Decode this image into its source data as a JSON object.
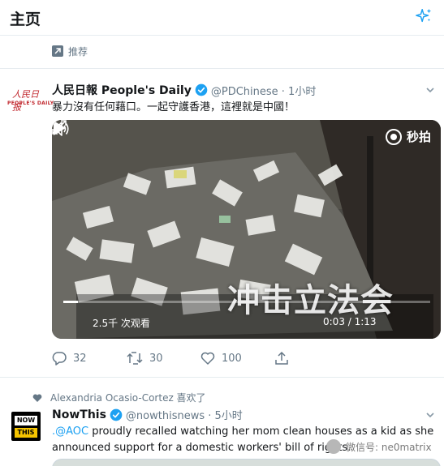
{
  "header": {
    "title": "主页",
    "sparkle_icon": "sparkle-icon"
  },
  "promoted": {
    "label": "推荐",
    "icon": "promoted-arrow-icon"
  },
  "tweet1": {
    "author_name": "人民日報 People's Daily",
    "handle": "@PDChinese · 1小时",
    "text": "暴力沒有任何藉口。一起守護香港，這裡就是中國！",
    "avatar": {
      "logo_text": "人民日报",
      "logo_sub": "PEOPLE'S DAILY"
    },
    "video": {
      "watermark": "秒拍",
      "caption": "冲击立法会",
      "views": "2.5千 次观看",
      "time": "0:03 / 1:13",
      "progress": 0.04
    },
    "actions": {
      "replies": "32",
      "retweets": "30",
      "likes": "100"
    }
  },
  "liked_by": {
    "label": "Alexandria Ocasio-Cortez 喜欢了"
  },
  "tweet2": {
    "author_name": "NowThis",
    "handle": "@nowthisnews · 5小时",
    "text_mention": ".@AOC",
    "text_rest": " proudly recalled watching her mom clean houses as a kid as she announced support for a domestic workers' bill of rights.",
    "avatar": {
      "line1": "NOW",
      "line2": "THIS"
    }
  },
  "wechat_watermark": {
    "label": "微信号: ne0matrix"
  },
  "colors": {
    "accent": "#1da1f2",
    "muted": "#657786",
    "text": "#14171a",
    "nowthis_yellow": "#f5c400"
  }
}
